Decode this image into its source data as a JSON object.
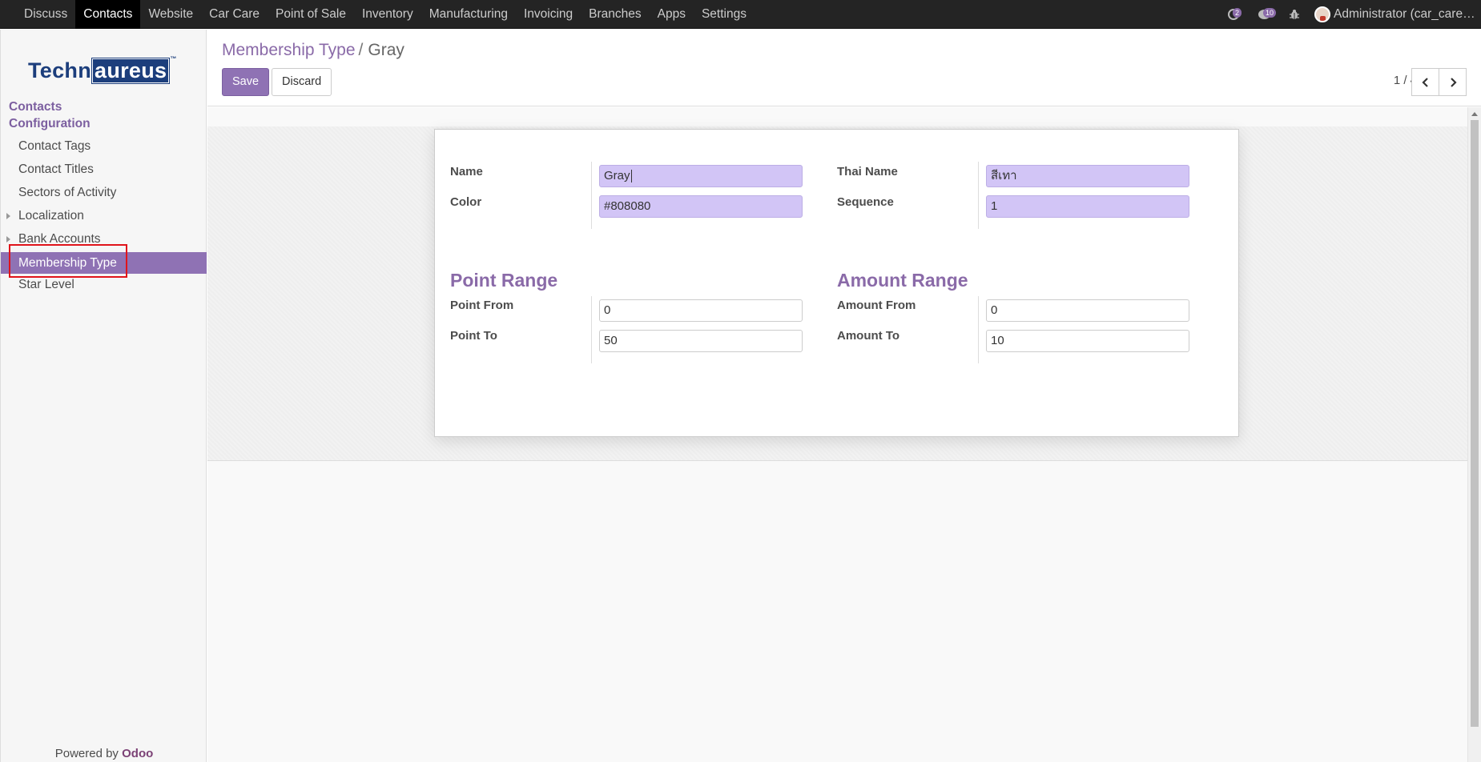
{
  "topbar": {
    "menus": [
      "Discuss",
      "Contacts",
      "Website",
      "Car Care",
      "Point of Sale",
      "Inventory",
      "Manufacturing",
      "Invoicing",
      "Branches",
      "Apps",
      "Settings"
    ],
    "active_menu": "Contacts",
    "activity_count": "2",
    "message_count": "10",
    "user": "Administrator (car_care…"
  },
  "sidebar": {
    "logo_part1": "Techn",
    "logo_part2": "aureus",
    "logo_tm": "™",
    "section1": "Contacts",
    "section2": "Configuration",
    "items": [
      "Contact Tags",
      "Contact Titles",
      "Sectors of Activity",
      "Localization",
      "Bank Accounts",
      "Membership Type",
      "Star Level"
    ],
    "selected_item": "Membership Type",
    "powered_by": "Powered by",
    "brand": "Odoo"
  },
  "control": {
    "breadcrumb_parent": "Membership Type",
    "breadcrumb_sep": "/",
    "breadcrumb_current": "Gray",
    "save_label": "Save",
    "discard_label": "Discard",
    "pager": "1 / 4"
  },
  "form": {
    "name_label": "Name",
    "name_value": "Gray",
    "thai_name_label": "Thai Name",
    "thai_name_value": "สีเทา",
    "color_label": "Color",
    "color_value": "#808080",
    "sequence_label": "Sequence",
    "sequence_value": "1",
    "point_range_title": "Point Range",
    "point_from_label": "Point From",
    "point_from_value": "0",
    "point_to_label": "Point To",
    "point_to_value": "50",
    "amount_range_title": "Amount Range",
    "amount_from_label": "Amount From",
    "amount_from_value": "0",
    "amount_to_label": "Amount To",
    "amount_to_value": "10"
  },
  "colors": {
    "accent": "#8f72b4",
    "accent_text": "#8a6aa8",
    "required_field": "#d2c5f6",
    "topbar": "#242424",
    "highlight": "#e0141b"
  }
}
